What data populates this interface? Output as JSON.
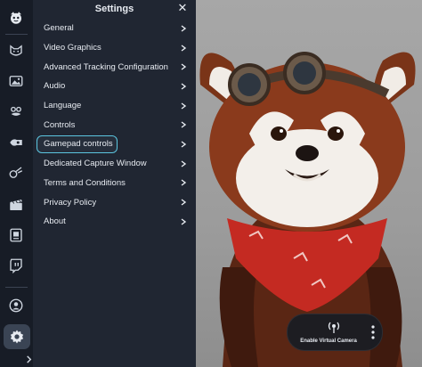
{
  "settings": {
    "title": "Settings",
    "close_glyph": "✕",
    "items": [
      {
        "label": "General"
      },
      {
        "label": "Video Graphics"
      },
      {
        "label": "Advanced Tracking Configuration"
      },
      {
        "label": "Audio"
      },
      {
        "label": "Language"
      },
      {
        "label": "Controls"
      },
      {
        "label": "Gamepad controls",
        "highlighted": true
      },
      {
        "label": "Dedicated Capture Window"
      },
      {
        "label": "Terms and Conditions"
      },
      {
        "label": "Privacy Policy"
      },
      {
        "label": "About"
      }
    ]
  },
  "rail": {
    "icons": [
      "app-logo-icon",
      "avatar-icon",
      "image-icon",
      "mask-icon",
      "animation-icon",
      "props-icon",
      "clapperboard-icon",
      "media-icon",
      "twitch-icon",
      "profile-icon",
      "gear-icon",
      "expand-icon"
    ]
  },
  "camera": {
    "button_label": "Enable Virtual Camera"
  },
  "colors": {
    "panel_bg": "#202632",
    "rail_bg": "#171c26",
    "highlight_border": "#5cc6e0",
    "fur_red": "#8a3a1c",
    "bandana_red": "#c42a22"
  }
}
